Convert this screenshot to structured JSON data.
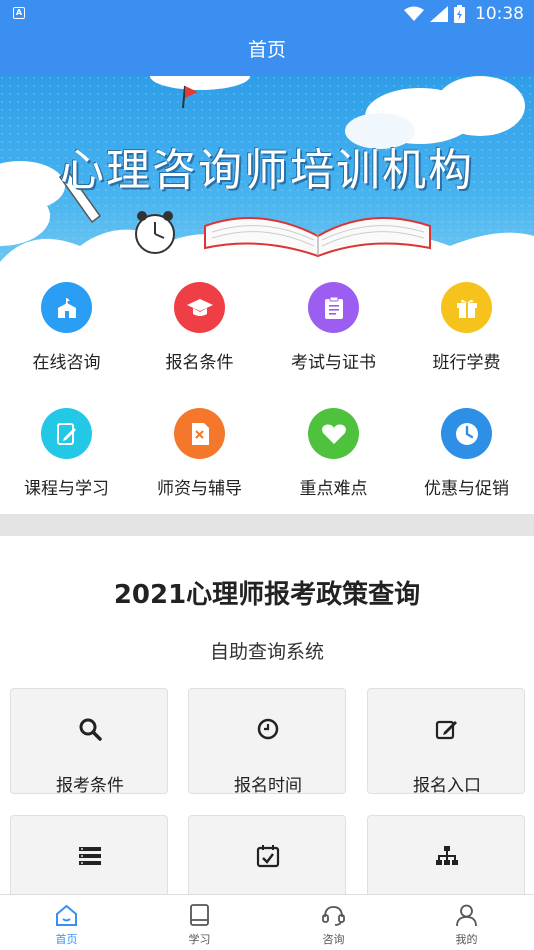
{
  "status_bar": {
    "time": "10:38",
    "app_icon_letter": "A"
  },
  "header": {
    "title": "首页"
  },
  "banner": {
    "title": "心理咨询师培训机构"
  },
  "menu": [
    {
      "label": "在线咨询",
      "icon": "school-icon",
      "color": "#2a9df4"
    },
    {
      "label": "报名条件",
      "icon": "graduation-cap-icon",
      "color": "#ef3e46"
    },
    {
      "label": "考试与证书",
      "icon": "clipboard-icon",
      "color": "#9c5ef0"
    },
    {
      "label": "班行学费",
      "icon": "gift-icon",
      "color": "#f6c31c"
    },
    {
      "label": "课程与学习",
      "icon": "edit-book-icon",
      "color": "#22c8e6"
    },
    {
      "label": "师资与辅导",
      "icon": "document-icon",
      "color": "#f4772c"
    },
    {
      "label": "重点难点",
      "icon": "heart-icon",
      "color": "#4ec23c"
    },
    {
      "label": "优惠与促销",
      "icon": "clock-icon",
      "color": "#2e8fe6"
    }
  ],
  "policy": {
    "title": "2021心理师报考政策查询",
    "subtitle": "自助查询系统",
    "cards": [
      {
        "label": "报考条件",
        "icon": "search-icon"
      },
      {
        "label": "报名时间",
        "icon": "clock-icon"
      },
      {
        "label": "报名入口",
        "icon": "edit-icon"
      },
      {
        "label": "",
        "icon": "list-icon"
      },
      {
        "label": "",
        "icon": "calendar-check-icon"
      },
      {
        "label": "",
        "icon": "sitemap-icon"
      }
    ]
  },
  "bottom_nav": [
    {
      "label": "首页",
      "icon": "home-icon",
      "active": true
    },
    {
      "label": "学习",
      "icon": "book-icon",
      "active": false
    },
    {
      "label": "咨询",
      "icon": "headset-icon",
      "active": false
    },
    {
      "label": "我的",
      "icon": "user-icon",
      "active": false
    }
  ],
  "colors": {
    "primary": "#3a8ff0",
    "divider": "#e4e4e4"
  }
}
